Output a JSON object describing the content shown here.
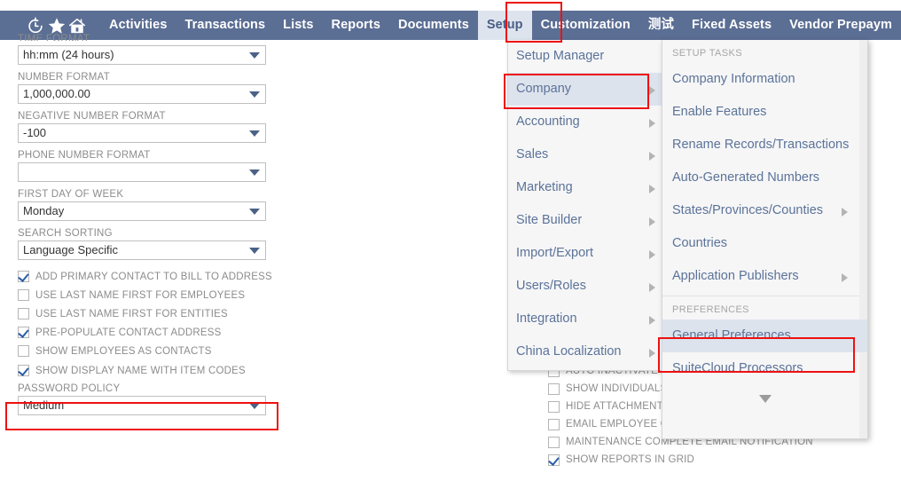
{
  "navbar": {
    "icons": [
      {
        "name": "recent-history-icon",
        "glyph": "↺"
      },
      {
        "name": "shortcuts-star-icon",
        "glyph": "★"
      },
      {
        "name": "home-icon",
        "glyph": "⌂"
      }
    ],
    "items": [
      {
        "label": "Activities",
        "active": false
      },
      {
        "label": "Transactions",
        "active": false
      },
      {
        "label": "Lists",
        "active": false
      },
      {
        "label": "Reports",
        "active": false
      },
      {
        "label": "Documents",
        "active": false
      },
      {
        "label": "Setup",
        "active": true
      },
      {
        "label": "Customization",
        "active": false
      },
      {
        "label": "测试",
        "active": false
      },
      {
        "label": "Fixed Assets",
        "active": false
      },
      {
        "label": "Vendor Prepaym",
        "active": false
      }
    ]
  },
  "form": {
    "clipped_label": "TIME FORMAT",
    "fields": [
      {
        "label": "TIME FORMAT",
        "value": "hh:mm (24 hours)"
      },
      {
        "label": "NUMBER FORMAT",
        "value": "1,000,000.00"
      },
      {
        "label": "NEGATIVE NUMBER FORMAT",
        "value": "-100"
      },
      {
        "label": "PHONE NUMBER FORMAT",
        "value": ""
      },
      {
        "label": "FIRST DAY OF WEEK",
        "value": "Monday"
      },
      {
        "label": "SEARCH SORTING",
        "value": "Language Specific"
      }
    ],
    "checkboxes": [
      {
        "label": "ADD PRIMARY CONTACT TO BILL TO ADDRESS",
        "checked": true
      },
      {
        "label": "USE LAST NAME FIRST FOR EMPLOYEES",
        "checked": false
      },
      {
        "label": "USE LAST NAME FIRST FOR ENTITIES",
        "checked": false
      },
      {
        "label": "PRE-POPULATE CONTACT ADDRESS",
        "checked": true
      },
      {
        "label": "SHOW EMPLOYEES AS CONTACTS",
        "checked": false
      },
      {
        "label": "SHOW DISPLAY NAME WITH ITEM CODES",
        "checked": true
      }
    ],
    "password_policy": {
      "label": "PASSWORD POLICY",
      "value": "Medium"
    }
  },
  "background_checkboxes": [
    {
      "label": "AUTO INACTIVATE",
      "checked": false
    },
    {
      "label": "SHOW INDIVIDUALS",
      "checked": false
    },
    {
      "label": "HIDE ATTACHMENT",
      "checked": false
    },
    {
      "label": "EMAIL EMPLOYEE ON APPROVALS",
      "checked": false
    },
    {
      "label": "MAINTENANCE COMPLETE EMAIL NOTIFICATION",
      "checked": false
    },
    {
      "label": "SHOW REPORTS IN GRID",
      "checked": true
    }
  ],
  "setup_menu": {
    "items": [
      {
        "label": "Setup Manager",
        "submenu": false,
        "selected": false
      },
      {
        "label": "Company",
        "submenu": true,
        "selected": true
      },
      {
        "label": "Accounting",
        "submenu": true,
        "selected": false
      },
      {
        "label": "Sales",
        "submenu": true,
        "selected": false
      },
      {
        "label": "Marketing",
        "submenu": true,
        "selected": false
      },
      {
        "label": "Site Builder",
        "submenu": true,
        "selected": false
      },
      {
        "label": "Import/Export",
        "submenu": true,
        "selected": false
      },
      {
        "label": "Users/Roles",
        "submenu": true,
        "selected": false
      },
      {
        "label": "Integration",
        "submenu": true,
        "selected": false
      },
      {
        "label": "China Localization",
        "submenu": true,
        "selected": false
      }
    ]
  },
  "company_submenu": {
    "section_setup_tasks": "SETUP TASKS",
    "setup_tasks": [
      {
        "label": "Company Information",
        "submenu": false,
        "selected": false
      },
      {
        "label": "Enable Features",
        "submenu": false,
        "selected": false
      },
      {
        "label": "Rename Records/Transactions",
        "submenu": false,
        "selected": false
      },
      {
        "label": "Auto-Generated Numbers",
        "submenu": false,
        "selected": false
      },
      {
        "label": "States/Provinces/Counties",
        "submenu": true,
        "selected": false
      },
      {
        "label": "Countries",
        "submenu": false,
        "selected": false
      },
      {
        "label": "Application Publishers",
        "submenu": true,
        "selected": false
      }
    ],
    "section_preferences": "PREFERENCES",
    "preferences": [
      {
        "label": "General Preferences",
        "submenu": false,
        "selected": true
      },
      {
        "label": "SuiteCloud Processors",
        "submenu": false,
        "selected": false
      }
    ],
    "more_indicator": "▼"
  },
  "annotations": {
    "highlight_color": "#ee1111",
    "boxes": [
      {
        "name": "setup-tab-highlight"
      },
      {
        "name": "company-menu-item-highlight"
      },
      {
        "name": "general-preferences-highlight"
      },
      {
        "name": "show-display-name-checkbox-highlight"
      }
    ]
  }
}
